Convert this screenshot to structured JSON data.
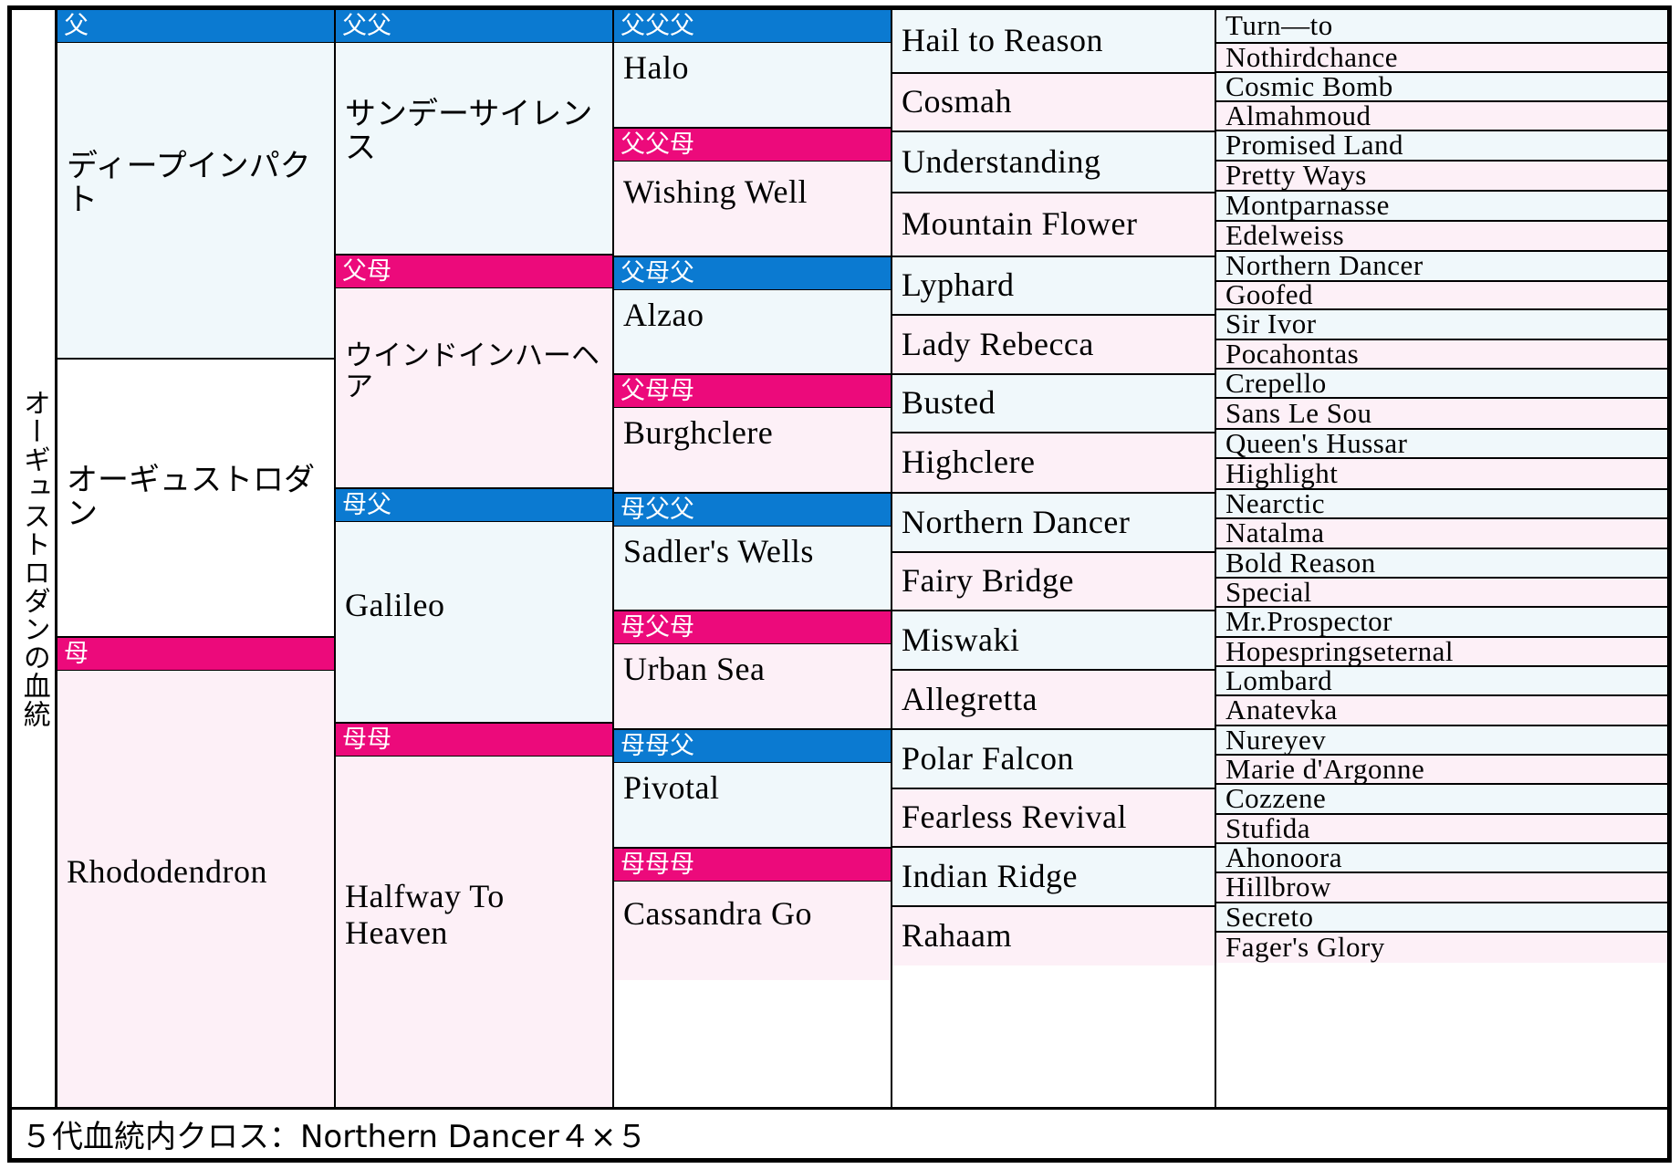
{
  "subject": {
    "vertical_label": "オーギュストロダンの血統"
  },
  "tags": {
    "sire": "父",
    "dam": "母",
    "sire_sire": "父父",
    "sire_dam": "父母",
    "dam_sire": "母父",
    "dam_dam": "母母",
    "sire_sire_sire": "父父父",
    "sire_sire_dam": "父父母",
    "sire_dam_sire": "父母父",
    "sire_dam_dam": "父母母",
    "dam_sire_sire": "母父父",
    "dam_sire_dam": "母父母",
    "dam_dam_sire": "母母父",
    "dam_dam_dam": "母母母"
  },
  "gen1": [
    {
      "name": "ディープインパクト",
      "tint": "sire"
    },
    {
      "name": "オーギュストロダン",
      "tint": "white"
    },
    {
      "name": "Rhododendron",
      "tint": "dam"
    }
  ],
  "gen2": [
    {
      "name": "サンデーサイレンス",
      "tint": "sire"
    },
    {
      "name": "ウインドインハーヘア",
      "tint": "dam"
    },
    {
      "name": "Galileo",
      "tint": "sire"
    },
    {
      "name": "Halfway To Heaven",
      "tint": "dam"
    }
  ],
  "gen3": [
    {
      "name": "Halo",
      "tint": "sire"
    },
    {
      "name": "Wishing Well",
      "tint": "dam"
    },
    {
      "name": "Alzao",
      "tint": "sire"
    },
    {
      "name": "Burghclere",
      "tint": "dam"
    },
    {
      "name": "Sadler's Wells",
      "tint": "sire"
    },
    {
      "name": "Urban Sea",
      "tint": "dam"
    },
    {
      "name": "Pivotal",
      "tint": "sire"
    },
    {
      "name": "Cassandra Go",
      "tint": "dam"
    }
  ],
  "gen4": [
    {
      "name": "Hail to Reason",
      "tint": "sire"
    },
    {
      "name": "Cosmah",
      "tint": "dam"
    },
    {
      "name": "Understanding",
      "tint": "sire"
    },
    {
      "name": "Mountain Flower",
      "tint": "dam"
    },
    {
      "name": "Lyphard",
      "tint": "sire"
    },
    {
      "name": "Lady Rebecca",
      "tint": "dam"
    },
    {
      "name": "Busted",
      "tint": "sire"
    },
    {
      "name": "Highclere",
      "tint": "dam"
    },
    {
      "name": "Northern Dancer",
      "tint": "sire"
    },
    {
      "name": "Fairy Bridge",
      "tint": "dam"
    },
    {
      "name": "Miswaki",
      "tint": "sire"
    },
    {
      "name": "Allegretta",
      "tint": "dam"
    },
    {
      "name": "Polar Falcon",
      "tint": "sire"
    },
    {
      "name": "Fearless Revival",
      "tint": "dam"
    },
    {
      "name": "Indian Ridge",
      "tint": "sire"
    },
    {
      "name": "Rahaam",
      "tint": "dam"
    }
  ],
  "gen5": [
    {
      "name": "Turn—to",
      "tint": "sire"
    },
    {
      "name": "Nothirdchance",
      "tint": "dam"
    },
    {
      "name": "Cosmic Bomb",
      "tint": "sire"
    },
    {
      "name": "Almahmoud",
      "tint": "dam"
    },
    {
      "name": "Promised Land",
      "tint": "sire"
    },
    {
      "name": "Pretty Ways",
      "tint": "dam"
    },
    {
      "name": "Montparnasse",
      "tint": "sire"
    },
    {
      "name": "Edelweiss",
      "tint": "dam"
    },
    {
      "name": "Northern Dancer",
      "tint": "sire"
    },
    {
      "name": "Goofed",
      "tint": "dam"
    },
    {
      "name": "Sir Ivor",
      "tint": "sire"
    },
    {
      "name": "Pocahontas",
      "tint": "dam"
    },
    {
      "name": "Crepello",
      "tint": "sire"
    },
    {
      "name": "Sans Le Sou",
      "tint": "dam"
    },
    {
      "name": "Queen's Hussar",
      "tint": "sire"
    },
    {
      "name": "Highlight",
      "tint": "dam"
    },
    {
      "name": "Nearctic",
      "tint": "sire"
    },
    {
      "name": "Natalma",
      "tint": "dam"
    },
    {
      "name": "Bold Reason",
      "tint": "sire"
    },
    {
      "name": "Special",
      "tint": "dam"
    },
    {
      "name": "Mr.Prospector",
      "tint": "sire"
    },
    {
      "name": "Hopespringseternal",
      "tint": "dam"
    },
    {
      "name": "Lombard",
      "tint": "sire"
    },
    {
      "name": "Anatevka",
      "tint": "dam"
    },
    {
      "name": "Nureyev",
      "tint": "sire"
    },
    {
      "name": "Marie d'Argonne",
      "tint": "dam"
    },
    {
      "name": "Cozzene",
      "tint": "sire"
    },
    {
      "name": "Stufida",
      "tint": "dam"
    },
    {
      "name": "Ahonoora",
      "tint": "sire"
    },
    {
      "name": "Hillbrow",
      "tint": "dam"
    },
    {
      "name": "Secreto",
      "tint": "sire"
    },
    {
      "name": "Fager's Glory",
      "tint": "dam"
    }
  ],
  "footer": {
    "note": "５代血統内クロス：Northern Dancer４×５"
  },
  "colors": {
    "sire_header": "#0b7ad1",
    "dam_header": "#ec0a7b",
    "sire_tint": "#f0f8fb",
    "dam_tint": "#fdf0f7",
    "border": "#000000"
  }
}
